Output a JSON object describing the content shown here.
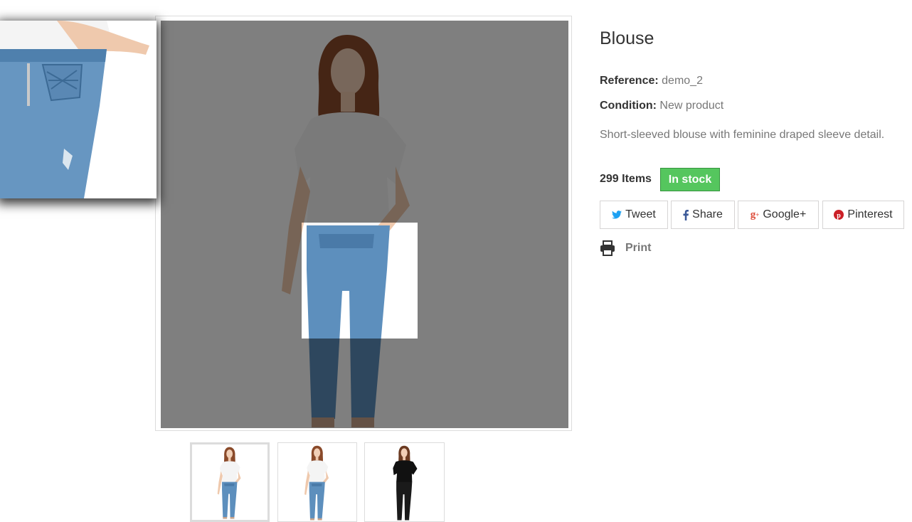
{
  "product": {
    "title": "Blouse",
    "reference_label": "Reference:",
    "reference_value": "demo_2",
    "condition_label": "Condition:",
    "condition_value": "New product",
    "description": "Short-sleeved blouse with feminine draped sleeve detail.",
    "quantity": "299",
    "quantity_unit": "Items",
    "stock_status": "In stock"
  },
  "share": {
    "tweet": "Tweet",
    "facebook": "Share",
    "google": "Google+",
    "pinterest": "Pinterest"
  },
  "print_label": "Print",
  "icons": [
    "twitter-icon",
    "facebook-icon",
    "google-plus-icon",
    "pinterest-icon",
    "print-icon"
  ],
  "colors": {
    "in_stock_bg": "#55c65e",
    "twitter": "#1da1f2",
    "facebook": "#3b5998",
    "google": "#dd4b39",
    "pinterest": "#cb2027"
  },
  "gallery": {
    "thumbnails": [
      "model in white blouse and jeans, front",
      "model in white blouse, full length",
      "model in black blouse"
    ],
    "active_thumbnail": 1
  }
}
